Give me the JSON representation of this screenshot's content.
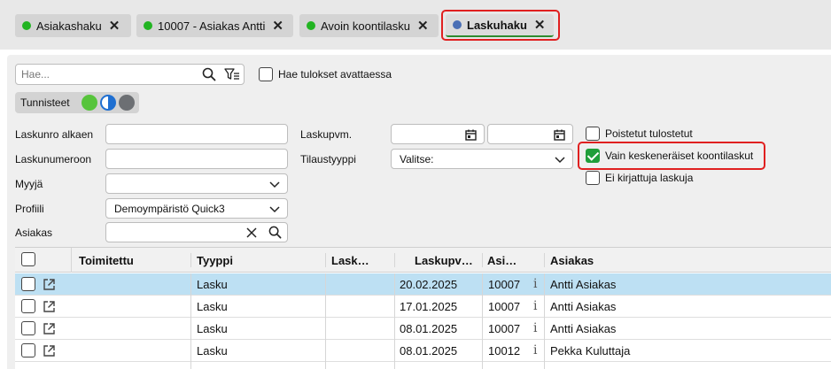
{
  "tabs": [
    {
      "label": "Asiakashaku",
      "dot_color": "#22b422"
    },
    {
      "label": "10007 - Asiakas Antti",
      "dot_color": "#22b422"
    },
    {
      "label": "Avoin koontilasku",
      "dot_color": "#22b422"
    },
    {
      "label": "Laskuhaku",
      "dot_color": "#4a6fb5",
      "active": true
    }
  ],
  "search": {
    "placeholder": "Hae...",
    "value": "",
    "open_results_label": "Hae tulokset avattaessa",
    "open_results_checked": false
  },
  "tags": {
    "label": "Tunnisteet"
  },
  "filters": {
    "invoice_from_label": "Laskunro alkaen",
    "invoice_to_label": "Laskunumeroon",
    "seller_label": "Myyjä",
    "profile_label": "Profiili",
    "profile_value": "Demoympäristö Quick3",
    "customer_label": "Asiakas",
    "date_label": "Laskupvm.",
    "order_type_label": "Tilaustyyppi",
    "order_type_value": "Valitse:",
    "deleted_printouts_label": "Poistetut tulostetut",
    "deleted_printouts_checked": false,
    "unfinished_collective_label": "Vain keskeneräiset koontilaskut",
    "unfinished_collective_checked": true,
    "unposted_label": "Ei kirjattuja laskuja",
    "unposted_checked": false
  },
  "table": {
    "columns": [
      "Toimitettu",
      "Tyyppi",
      "Lask…",
      "Laskupv…",
      "Asi…",
      "Asiakas"
    ],
    "rows": [
      {
        "delivered": "",
        "type": "Lasku",
        "invoice": "",
        "date": "20.02.2025",
        "customer_no": "10007",
        "customer": "Antti Asiakas",
        "selected": true
      },
      {
        "delivered": "",
        "type": "Lasku",
        "invoice": "",
        "date": "17.01.2025",
        "customer_no": "10007",
        "customer": "Antti Asiakas"
      },
      {
        "delivered": "",
        "type": "Lasku",
        "invoice": "",
        "date": "08.01.2025",
        "customer_no": "10007",
        "customer": "Antti Asiakas"
      },
      {
        "delivered": "",
        "type": "Lasku",
        "invoice": "",
        "date": "08.01.2025",
        "customer_no": "10012",
        "customer": "Pekka Kuluttaja"
      }
    ]
  },
  "icons": {
    "info_glyph": "i"
  },
  "colors": {
    "accent_green": "#1f9e3a",
    "highlight_red": "#e02020",
    "selected_row": "#bde0f3"
  }
}
